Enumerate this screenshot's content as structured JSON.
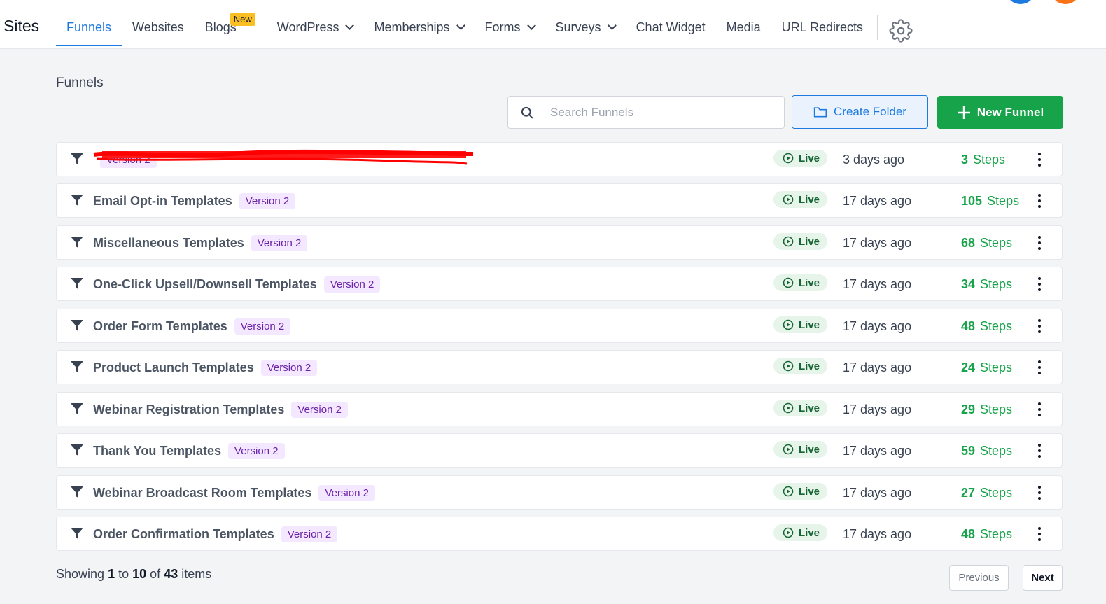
{
  "app": {
    "brand": "Sites",
    "nav": [
      {
        "label": "Funnels",
        "active": true
      },
      {
        "label": "Websites"
      },
      {
        "label": "Blogs",
        "badge": "New"
      },
      {
        "label": "WordPress",
        "dropdown": true
      },
      {
        "label": "Memberships",
        "dropdown": true
      },
      {
        "label": "Forms",
        "dropdown": true
      },
      {
        "label": "Surveys",
        "dropdown": true
      },
      {
        "label": "Chat Widget"
      },
      {
        "label": "Media"
      },
      {
        "label": "URL Redirects"
      }
    ],
    "settings_icon": "gear-icon"
  },
  "page": {
    "title": "Funnels",
    "search_placeholder": "Search Funnels",
    "create_folder_label": "Create Folder",
    "new_funnel_label": "New Funnel"
  },
  "funnels": [
    {
      "name": "",
      "version": "Version 2",
      "status": "Live",
      "updated": "3 days ago",
      "steps_count": "3",
      "steps_label": "Steps",
      "redacted": true
    },
    {
      "name": "Email Opt-in Templates",
      "version": "Version 2",
      "status": "Live",
      "updated": "17 days ago",
      "steps_count": "105",
      "steps_label": "Steps"
    },
    {
      "name": "Miscellaneous Templates",
      "version": "Version 2",
      "status": "Live",
      "updated": "17 days ago",
      "steps_count": "68",
      "steps_label": "Steps"
    },
    {
      "name": "One-Click Upsell/Downsell Templates",
      "version": "Version 2",
      "status": "Live",
      "updated": "17 days ago",
      "steps_count": "34",
      "steps_label": "Steps"
    },
    {
      "name": "Order Form Templates",
      "version": "Version 2",
      "status": "Live",
      "updated": "17 days ago",
      "steps_count": "48",
      "steps_label": "Steps"
    },
    {
      "name": "Product Launch Templates",
      "version": "Version 2",
      "status": "Live",
      "updated": "17 days ago",
      "steps_count": "24",
      "steps_label": "Steps"
    },
    {
      "name": "Webinar Registration Templates",
      "version": "Version 2",
      "status": "Live",
      "updated": "17 days ago",
      "steps_count": "29",
      "steps_label": "Steps"
    },
    {
      "name": "Thank You Templates",
      "version": "Version 2",
      "status": "Live",
      "updated": "17 days ago",
      "steps_count": "59",
      "steps_label": "Steps"
    },
    {
      "name": "Webinar Broadcast Room Templates",
      "version": "Version 2",
      "status": "Live",
      "updated": "17 days ago",
      "steps_count": "27",
      "steps_label": "Steps"
    },
    {
      "name": "Order Confirmation Templates",
      "version": "Version 2",
      "status": "Live",
      "updated": "17 days ago",
      "steps_count": "48",
      "steps_label": "Steps"
    }
  ],
  "pagination": {
    "showing_prefix": "Showing",
    "from": "1",
    "to_word": "to",
    "to": "10",
    "of_word": "of",
    "total": "43",
    "items_word": "items",
    "previous_label": "Previous",
    "next_label": "Next"
  },
  "colors": {
    "accent": "#1f7ae0",
    "success": "#16a34a",
    "version_badge_bg": "#f3e8ff",
    "new_badge": "#fbbf24"
  }
}
